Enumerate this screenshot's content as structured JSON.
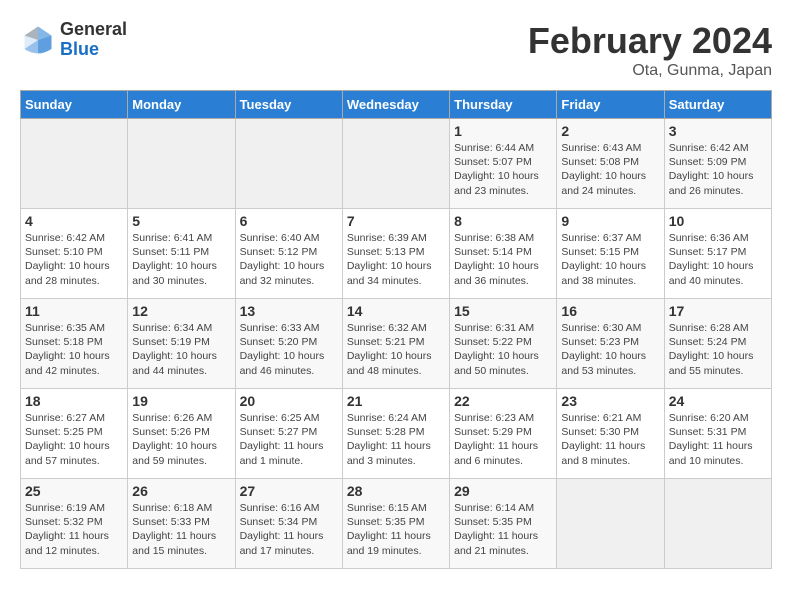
{
  "header": {
    "logo_general": "General",
    "logo_blue": "Blue",
    "month_title": "February 2024",
    "location": "Ota, Gunma, Japan"
  },
  "days_of_week": [
    "Sunday",
    "Monday",
    "Tuesday",
    "Wednesday",
    "Thursday",
    "Friday",
    "Saturday"
  ],
  "weeks": [
    [
      {
        "day": "",
        "info": ""
      },
      {
        "day": "",
        "info": ""
      },
      {
        "day": "",
        "info": ""
      },
      {
        "day": "",
        "info": ""
      },
      {
        "day": "1",
        "info": "Sunrise: 6:44 AM\nSunset: 5:07 PM\nDaylight: 10 hours\nand 23 minutes."
      },
      {
        "day": "2",
        "info": "Sunrise: 6:43 AM\nSunset: 5:08 PM\nDaylight: 10 hours\nand 24 minutes."
      },
      {
        "day": "3",
        "info": "Sunrise: 6:42 AM\nSunset: 5:09 PM\nDaylight: 10 hours\nand 26 minutes."
      }
    ],
    [
      {
        "day": "4",
        "info": "Sunrise: 6:42 AM\nSunset: 5:10 PM\nDaylight: 10 hours\nand 28 minutes."
      },
      {
        "day": "5",
        "info": "Sunrise: 6:41 AM\nSunset: 5:11 PM\nDaylight: 10 hours\nand 30 minutes."
      },
      {
        "day": "6",
        "info": "Sunrise: 6:40 AM\nSunset: 5:12 PM\nDaylight: 10 hours\nand 32 minutes."
      },
      {
        "day": "7",
        "info": "Sunrise: 6:39 AM\nSunset: 5:13 PM\nDaylight: 10 hours\nand 34 minutes."
      },
      {
        "day": "8",
        "info": "Sunrise: 6:38 AM\nSunset: 5:14 PM\nDaylight: 10 hours\nand 36 minutes."
      },
      {
        "day": "9",
        "info": "Sunrise: 6:37 AM\nSunset: 5:15 PM\nDaylight: 10 hours\nand 38 minutes."
      },
      {
        "day": "10",
        "info": "Sunrise: 6:36 AM\nSunset: 5:17 PM\nDaylight: 10 hours\nand 40 minutes."
      }
    ],
    [
      {
        "day": "11",
        "info": "Sunrise: 6:35 AM\nSunset: 5:18 PM\nDaylight: 10 hours\nand 42 minutes."
      },
      {
        "day": "12",
        "info": "Sunrise: 6:34 AM\nSunset: 5:19 PM\nDaylight: 10 hours\nand 44 minutes."
      },
      {
        "day": "13",
        "info": "Sunrise: 6:33 AM\nSunset: 5:20 PM\nDaylight: 10 hours\nand 46 minutes."
      },
      {
        "day": "14",
        "info": "Sunrise: 6:32 AM\nSunset: 5:21 PM\nDaylight: 10 hours\nand 48 minutes."
      },
      {
        "day": "15",
        "info": "Sunrise: 6:31 AM\nSunset: 5:22 PM\nDaylight: 10 hours\nand 50 minutes."
      },
      {
        "day": "16",
        "info": "Sunrise: 6:30 AM\nSunset: 5:23 PM\nDaylight: 10 hours\nand 53 minutes."
      },
      {
        "day": "17",
        "info": "Sunrise: 6:28 AM\nSunset: 5:24 PM\nDaylight: 10 hours\nand 55 minutes."
      }
    ],
    [
      {
        "day": "18",
        "info": "Sunrise: 6:27 AM\nSunset: 5:25 PM\nDaylight: 10 hours\nand 57 minutes."
      },
      {
        "day": "19",
        "info": "Sunrise: 6:26 AM\nSunset: 5:26 PM\nDaylight: 10 hours\nand 59 minutes."
      },
      {
        "day": "20",
        "info": "Sunrise: 6:25 AM\nSunset: 5:27 PM\nDaylight: 11 hours\nand 1 minute."
      },
      {
        "day": "21",
        "info": "Sunrise: 6:24 AM\nSunset: 5:28 PM\nDaylight: 11 hours\nand 3 minutes."
      },
      {
        "day": "22",
        "info": "Sunrise: 6:23 AM\nSunset: 5:29 PM\nDaylight: 11 hours\nand 6 minutes."
      },
      {
        "day": "23",
        "info": "Sunrise: 6:21 AM\nSunset: 5:30 PM\nDaylight: 11 hours\nand 8 minutes."
      },
      {
        "day": "24",
        "info": "Sunrise: 6:20 AM\nSunset: 5:31 PM\nDaylight: 11 hours\nand 10 minutes."
      }
    ],
    [
      {
        "day": "25",
        "info": "Sunrise: 6:19 AM\nSunset: 5:32 PM\nDaylight: 11 hours\nand 12 minutes."
      },
      {
        "day": "26",
        "info": "Sunrise: 6:18 AM\nSunset: 5:33 PM\nDaylight: 11 hours\nand 15 minutes."
      },
      {
        "day": "27",
        "info": "Sunrise: 6:16 AM\nSunset: 5:34 PM\nDaylight: 11 hours\nand 17 minutes."
      },
      {
        "day": "28",
        "info": "Sunrise: 6:15 AM\nSunset: 5:35 PM\nDaylight: 11 hours\nand 19 minutes."
      },
      {
        "day": "29",
        "info": "Sunrise: 6:14 AM\nSunset: 5:35 PM\nDaylight: 11 hours\nand 21 minutes."
      },
      {
        "day": "",
        "info": ""
      },
      {
        "day": "",
        "info": ""
      }
    ]
  ]
}
